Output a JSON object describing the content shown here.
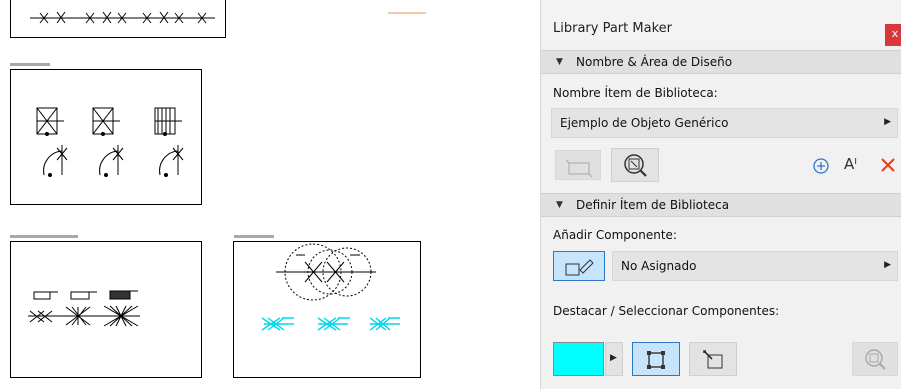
{
  "panel": {
    "title": "Library Part Maker",
    "close_glyph": "x",
    "section1": {
      "title": "Nombre & Área de Diseño"
    },
    "name_label": "Nombre Ítem de Biblioteca:",
    "name_value": "Ejemplo de Objeto Genérico",
    "section2": {
      "title": "Definir Ítem de Biblioteca"
    },
    "add_component_label": "Añadir Componente:",
    "component_value": "No Asignado",
    "highlight_label": "Destacar / Seleccionar Componentes:",
    "highlight_color": "#00ffff",
    "text_tool_glyph": "Aᴵ",
    "delete_color": "#e8401c",
    "accent_color": "#2e77c8"
  },
  "icons": [
    "zoom-icon",
    "box-icon",
    "add-circle-icon",
    "text-size-icon",
    "delete-icon",
    "pencil-box-icon",
    "selection-box-icon",
    "corner-select-icon",
    "dropdown-arrow-icon"
  ]
}
